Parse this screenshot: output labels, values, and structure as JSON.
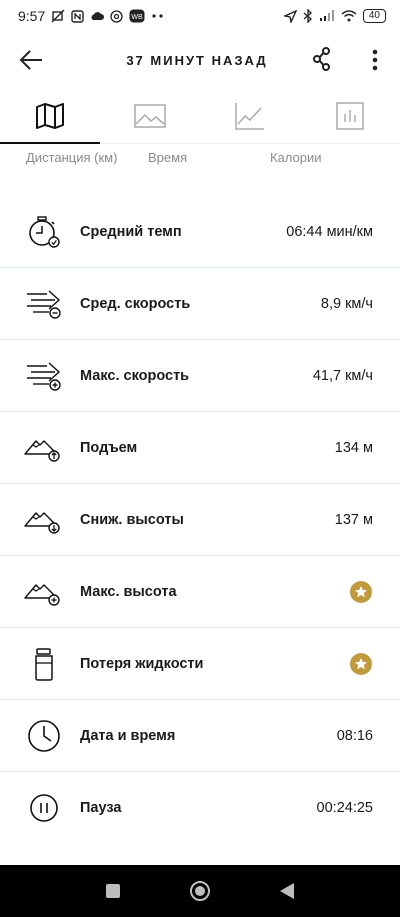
{
  "status_bar": {
    "time": "9:57",
    "battery": "40"
  },
  "header": {
    "title": "37 МИНУТ НАЗАД"
  },
  "tabs": [
    {
      "icon": "map-icon",
      "active": true
    },
    {
      "icon": "image-icon",
      "active": false
    },
    {
      "icon": "line-chart-icon",
      "active": false
    },
    {
      "icon": "bar-chart-icon",
      "active": false
    }
  ],
  "tab_labels": {
    "distance": "Дистанция (км)",
    "time": "Время",
    "calories": "Калории"
  },
  "stats": [
    {
      "icon": "stopwatch-icon",
      "label": "Средний темп",
      "value": "06:44 мин/км"
    },
    {
      "icon": "speed-lines-minus-icon",
      "label": "Сред. скорость",
      "value": "8,9 км/ч"
    },
    {
      "icon": "speed-lines-plus-icon",
      "label": "Макс. скорость",
      "value": "41,7 км/ч"
    },
    {
      "icon": "mountain-up-icon",
      "label": "Подъем",
      "value": "134 м"
    },
    {
      "icon": "mountain-down-icon",
      "label": "Сниж. высоты",
      "value": "137 м"
    },
    {
      "icon": "mountain-plus-icon",
      "label": "Макс. высота",
      "value": "",
      "premium": true
    },
    {
      "icon": "bottle-icon",
      "label": "Потеря жидкости",
      "value": "",
      "premium": true
    },
    {
      "icon": "clock-icon",
      "label": "Дата и время",
      "value": "08:16"
    },
    {
      "icon": "pause-icon",
      "label": "Пауза",
      "value": "00:24:25"
    }
  ],
  "colors": {
    "premium_star": "#c09a3e",
    "nav_bar": "#000000"
  }
}
